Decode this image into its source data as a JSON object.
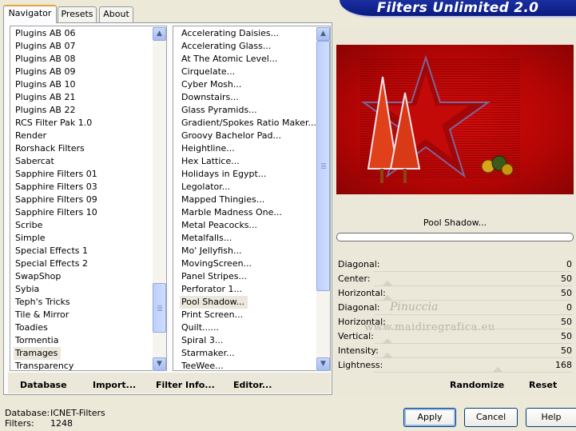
{
  "tabs": [
    {
      "label": "Navigator"
    },
    {
      "label": "Presets"
    },
    {
      "label": "About"
    }
  ],
  "banner": {
    "title": "Filters Unlimited 2.0"
  },
  "categories": [
    "Plugins AB 06",
    "Plugins AB 07",
    "Plugins AB 08",
    "Plugins AB 09",
    "Plugins AB 10",
    "Plugins AB 21",
    "Plugins AB 22",
    "RCS Filter Pak 1.0",
    "Render",
    "Rorshack Filters",
    "Sabercat",
    "Sapphire Filters 01",
    "Sapphire Filters 03",
    "Sapphire Filters 09",
    "Sapphire Filters 10",
    "Scribe",
    "Simple",
    "Special Effects 1",
    "Special Effects 2",
    "SwapShop",
    "Sybia",
    "Teph's Tricks",
    "Tile & Mirror",
    "Toadies",
    "Tormentia",
    "Tramages",
    "Transparency"
  ],
  "selected_category": "Tramages",
  "filters": [
    "Accelerating Daisies...",
    "Accelerating Glass...",
    "At The Atomic Level...",
    "Cirquelate...",
    "Cyber Mosh...",
    "Downstairs...",
    "Glass Pyramids...",
    "Gradient/Spokes Ratio Maker...",
    "Groovy Bachelor Pad...",
    "Heightline...",
    "Hex Lattice...",
    "Holidays in Egypt...",
    "Legolator...",
    "Mapped Thingies...",
    "Marble Madness One...",
    "Metal Peacocks...",
    "Metalfalls...",
    "Mo' Jellyfish...",
    "MovingScreen...",
    "Panel Stripes...",
    "Perforator 1...",
    "Pool Shadow...",
    "Print Screen...",
    "Quilt......",
    "Spiral 3...",
    "Starmaker...",
    "TeeWee..."
  ],
  "selected_filter": "Pool Shadow...",
  "list_buttons": {
    "database": "Database",
    "import": "Import...",
    "filter_info": "Filter Info...",
    "editor": "Editor..."
  },
  "filter_title": "Pool Shadow...",
  "parameters": [
    {
      "label": "Diagonal:",
      "value": "0"
    },
    {
      "label": "Center:",
      "value": "50"
    },
    {
      "label": "Horizontal:",
      "value": "50"
    },
    {
      "label": "Diagonal:",
      "value": "0"
    },
    {
      "label": "Horizontal:",
      "value": "50"
    },
    {
      "label": "Vertical:",
      "value": "50"
    },
    {
      "label": "Intensity:",
      "value": "50"
    },
    {
      "label": "Lightness:",
      "value": "168"
    }
  ],
  "param_buttons": {
    "randomize": "Randomize",
    "reset": "Reset"
  },
  "watermark": {
    "line1": "Pinuccia",
    "line2": "www.maidiregrafica.eu"
  },
  "status": {
    "database_label": "Database:",
    "database_value": "ICNET-Filters",
    "filters_label": "Filters:",
    "filters_value": "1248"
  },
  "dialog_buttons": {
    "apply": "Apply",
    "cancel": "Cancel",
    "help": "Help"
  },
  "colors": {
    "accent": "#e6a33c",
    "banner": "#0a1a80",
    "preview_bg": "#c00808"
  }
}
